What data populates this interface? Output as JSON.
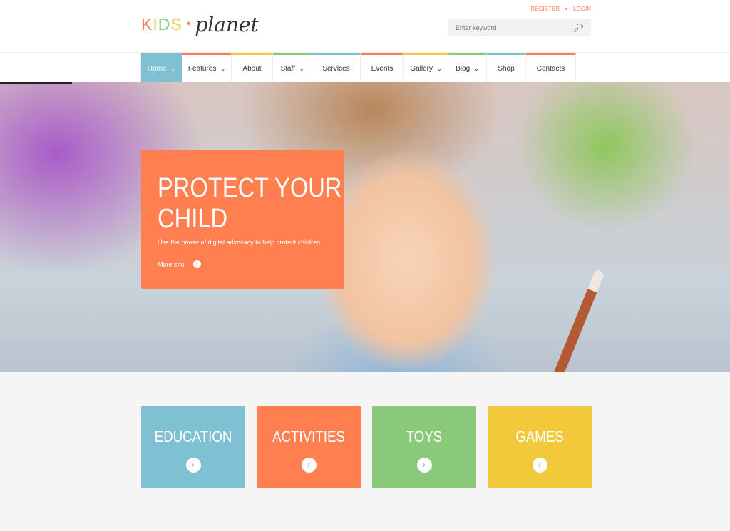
{
  "header": {
    "logo": {
      "kids": [
        "K",
        "I",
        "D",
        "S"
      ],
      "kids_colors": [
        "#ff7f50",
        "#f2c93a",
        "#8bc97a",
        "#f2c93a"
      ],
      "planet": "planet"
    },
    "register": "REGISTER",
    "login": "LOGIN",
    "search_placeholder": "Enter keyword",
    "search_icon": "search-icon"
  },
  "nav": {
    "items": [
      {
        "label": "Home",
        "dropdown": true,
        "active": true
      },
      {
        "label": "Features",
        "dropdown": true,
        "color": "#ff7f50"
      },
      {
        "label": "About",
        "dropdown": false,
        "color": "#f2c93a"
      },
      {
        "label": "Staff",
        "dropdown": true,
        "color": "#8bc97a"
      },
      {
        "label": "Services",
        "dropdown": false,
        "color": "#7fc1d3"
      },
      {
        "label": "Events",
        "dropdown": false,
        "color": "#ff7f50"
      },
      {
        "label": "Gallery",
        "dropdown": true,
        "color": "#f2c93a"
      },
      {
        "label": "Blog",
        "dropdown": true,
        "color": "#8bc97a"
      },
      {
        "label": "Shop",
        "dropdown": false,
        "color": "#7fc1d3"
      },
      {
        "label": "Contacts",
        "dropdown": false,
        "color": "#ff7f50"
      }
    ]
  },
  "hero": {
    "title_line1": "PROTECT YOUR",
    "title_line2": "CHILD",
    "subtitle": "Use the power of digital advocacy to help protect children",
    "more": "More info"
  },
  "categories": [
    {
      "label": "EDUCATION",
      "color": "#7fc1d3"
    },
    {
      "label": "ACTIVITIES",
      "color": "#ff7f50"
    },
    {
      "label": "TOYS",
      "color": "#8bc97a"
    },
    {
      "label": "GAMES",
      "color": "#f2c93a"
    }
  ]
}
